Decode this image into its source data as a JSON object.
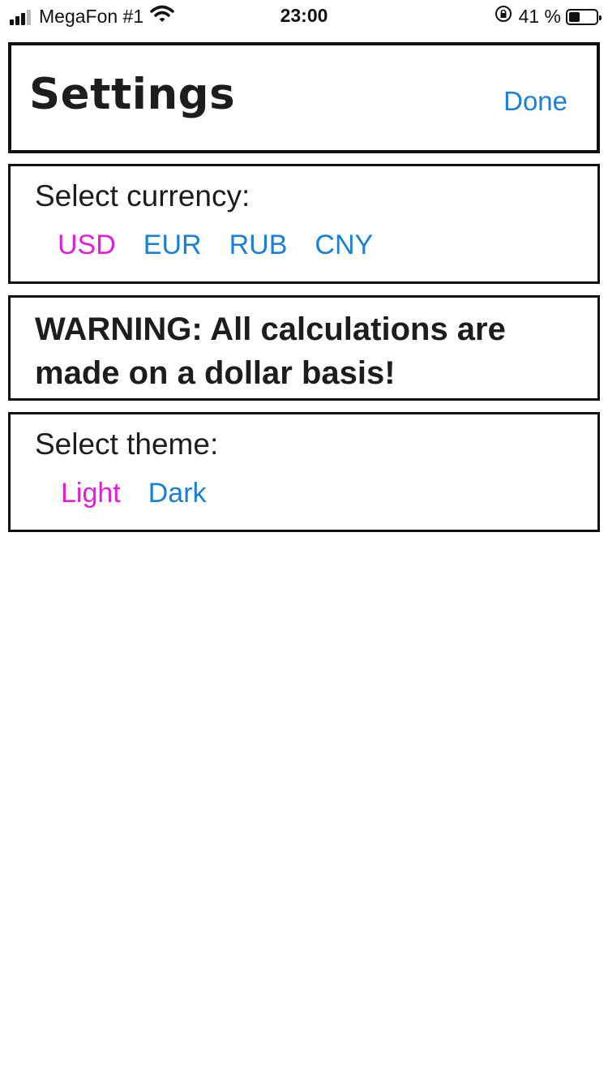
{
  "status_bar": {
    "carrier": "MegaFon #1",
    "time": "23:00",
    "battery_percent": "41 %",
    "battery_level": 0.41
  },
  "header": {
    "title": "Settings",
    "done_label": "Done"
  },
  "currency": {
    "label": "Select currency:",
    "options": [
      "USD",
      "EUR",
      "RUB",
      "CNY"
    ],
    "selected": "USD"
  },
  "warning": {
    "text": "WARNING: All calculations are made on a dollar basis!"
  },
  "theme": {
    "label": "Select theme:",
    "options": [
      "Light",
      "Dark"
    ],
    "selected": "Light"
  },
  "colors": {
    "accent": "#1a7fd6",
    "selected": "#e01fd6",
    "border": "#111111"
  }
}
